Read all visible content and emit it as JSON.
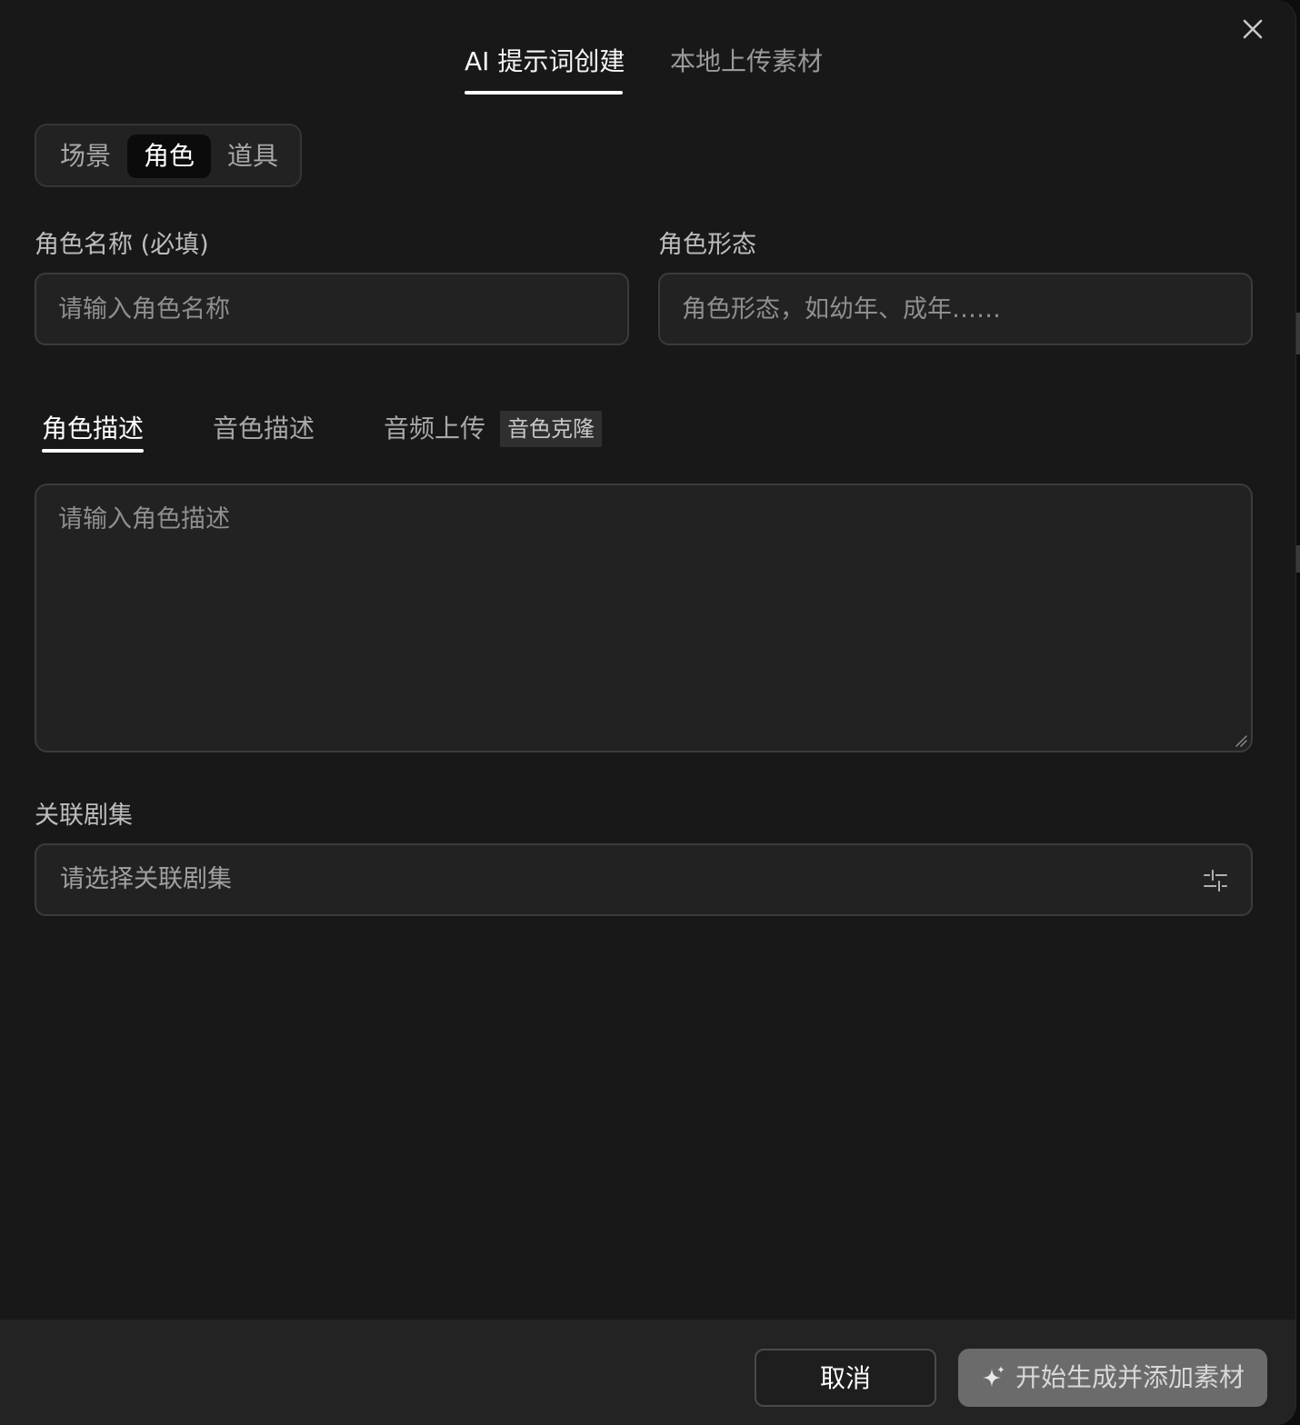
{
  "dialog": {
    "top_tabs": [
      {
        "label": "AI 提示词创建",
        "active": true
      },
      {
        "label": "本地上传素材",
        "active": false
      }
    ],
    "close_icon": "close-icon"
  },
  "category_segment": {
    "items": [
      {
        "label": "场景",
        "active": false
      },
      {
        "label": "角色",
        "active": true
      },
      {
        "label": "道具",
        "active": false
      }
    ]
  },
  "form": {
    "name": {
      "label": "角色名称 (必填)",
      "placeholder": "请输入角色名称",
      "value": ""
    },
    "form_state": {
      "label": "角色形态",
      "placeholder": "角色形态，如幼年、成年……",
      "value": ""
    },
    "sub_tabs": [
      {
        "label": "角色描述",
        "active": true
      },
      {
        "label": "音色描述",
        "active": false
      },
      {
        "label": "音频上传",
        "active": false
      }
    ],
    "badge": "音色克隆",
    "description": {
      "placeholder": "请输入角色描述",
      "value": ""
    },
    "episodes": {
      "label": "关联剧集",
      "placeholder": "请选择关联剧集",
      "icon": "filter-sliders-icon"
    }
  },
  "footer": {
    "cancel_label": "取消",
    "generate_label": "开始生成并添加素材",
    "generate_icon": "sparkle-icon"
  },
  "colors": {
    "background": "#181818",
    "field_bg": "#222222",
    "border": "#3b3b3b",
    "primary_disabled": "#6b6b6b"
  }
}
